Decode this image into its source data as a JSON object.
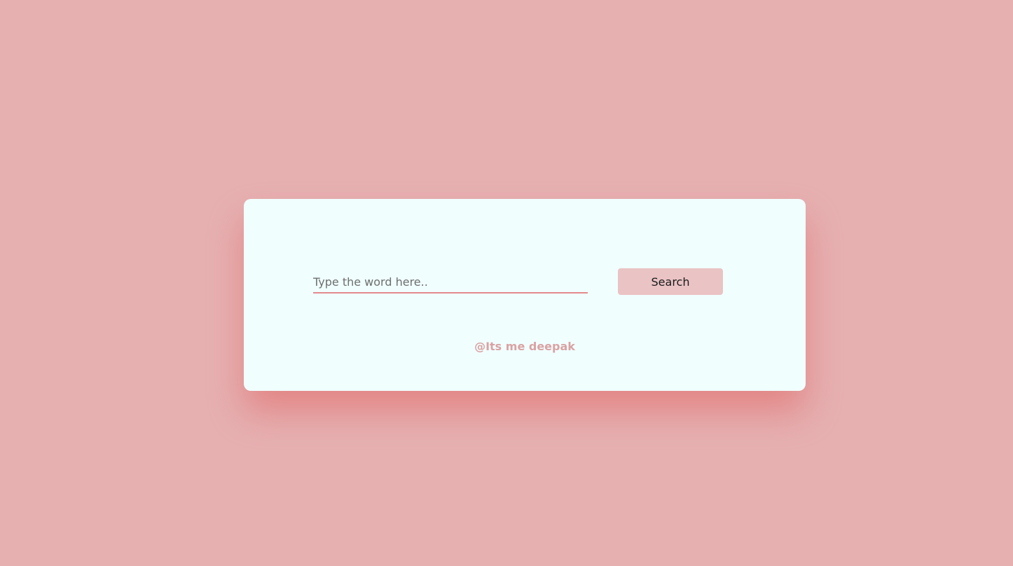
{
  "search": {
    "placeholder": "Type the word here..",
    "value": "",
    "button_label": "Search"
  },
  "footer": {
    "credit": "@Its me deepak"
  },
  "colors": {
    "background": "#e6b0b1",
    "card": "#f0fffe",
    "input_underline": "#e48a8d",
    "button": "#eac3c4",
    "credit_text": "#dba2a3"
  }
}
